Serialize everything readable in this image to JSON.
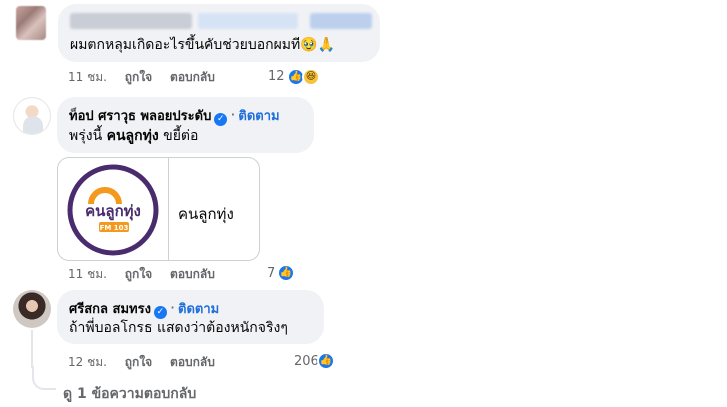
{
  "comments": [
    {
      "text": "ผมตกหลุมเกิดอะไรขึ้นคับช่วยบอกผมที",
      "emoji": "🥹🙏",
      "time": "11 ชม.",
      "like_label": "ถูกใจ",
      "reply_label": "ตอบกลับ",
      "reaction_count": "12"
    },
    {
      "author": "ท็อป ศราวุธ พลอยประดับ",
      "follow_label": "ติดตาม",
      "text_prefix": "พรุ่งนี้ ",
      "text_bold": "คนลูกทุ่ง",
      "text_suffix": " ขยี้ต่อ",
      "link_title": "คนลูกทุ่ง",
      "logo_text": "คนลูกทุ่ง",
      "logo_sub": "FM 103",
      "time": "11 ชม.",
      "like_label": "ถูกใจ",
      "reply_label": "ตอบกลับ",
      "reaction_count": "7"
    },
    {
      "author": "ศรีสกล สมทรง",
      "follow_label": "ติดตาม",
      "text": "ถ้าพี่บอลโกรธ แสดงว่าต้องหนักจริงๆ",
      "time": "12 ชม.",
      "like_label": "ถูกใจ",
      "reply_label": "ตอบกลับ",
      "reaction_count": "206"
    }
  ],
  "view_replies": "ดู 1 ข้อความตอบกลับ",
  "colors": {
    "bubble": "#f0f2f5",
    "link": "#216fdb",
    "meta": "#65676b",
    "like": "#1877f2",
    "logo_purple": "#4a2c6e",
    "logo_orange": "#f39a1e"
  }
}
